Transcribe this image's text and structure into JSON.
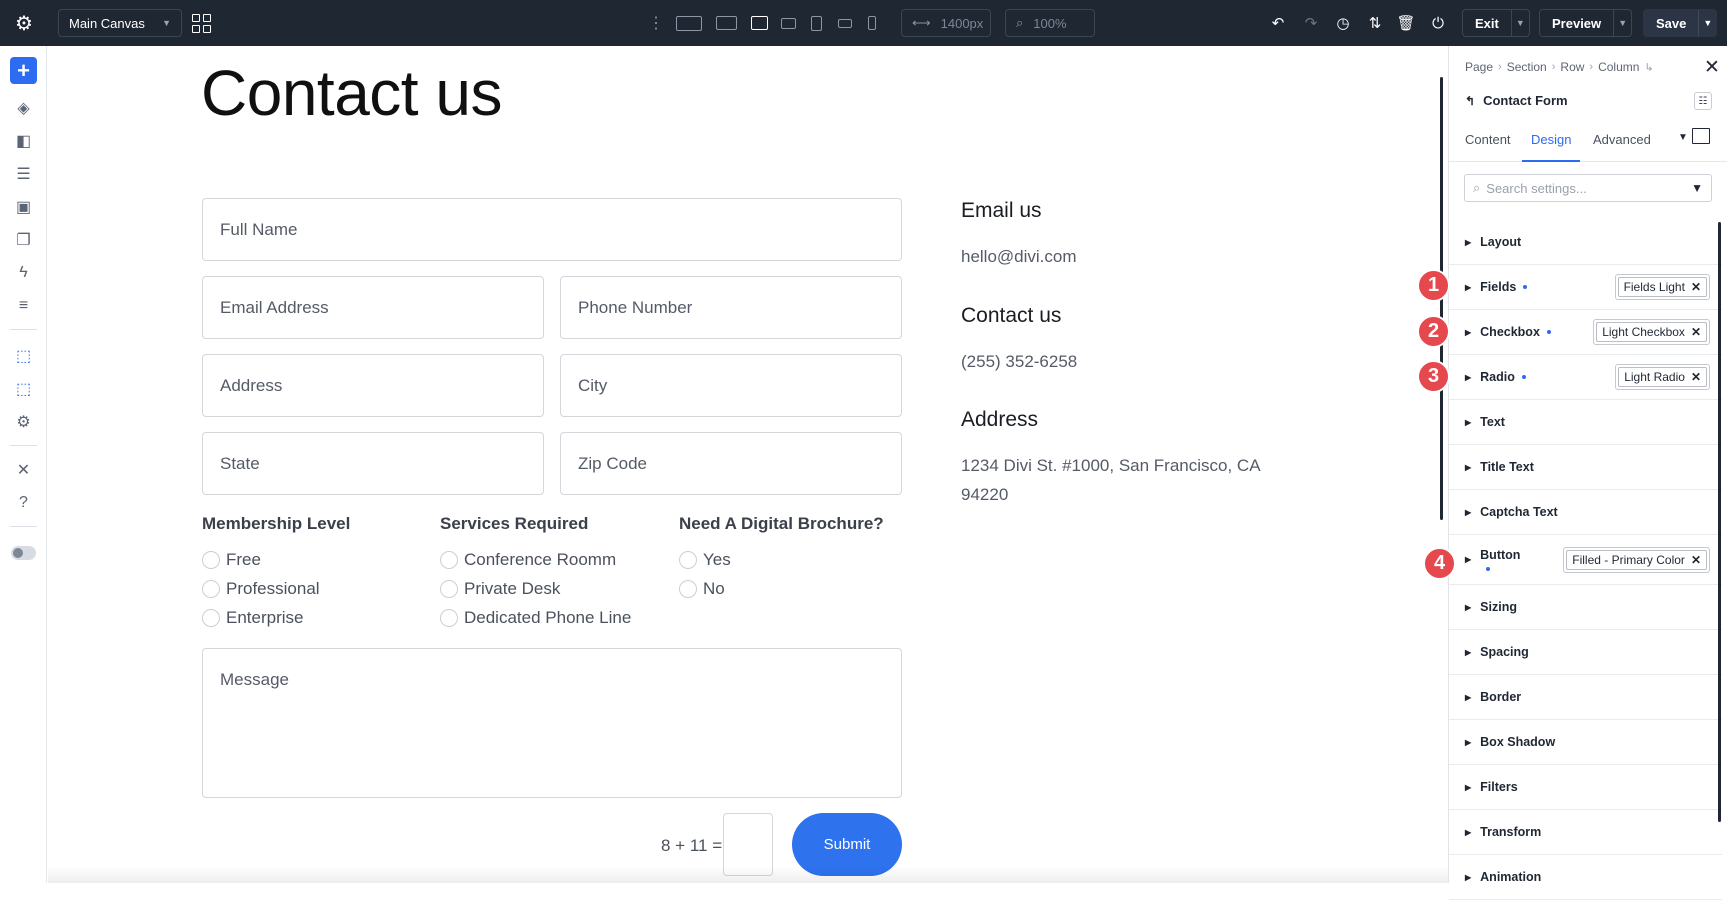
{
  "topbar": {
    "canvas_select": "Main Canvas",
    "width_value": "1400px",
    "zoom_value": "100%",
    "exit_label": "Exit",
    "preview_label": "Preview",
    "save_label": "Save"
  },
  "page": {
    "heading": "Contact us",
    "fields": {
      "full_name": "Full Name",
      "email": "Email Address",
      "phone": "Phone Number",
      "address": "Address",
      "city": "City",
      "state": "State",
      "zip": "Zip Code",
      "message": "Message"
    },
    "groups": [
      {
        "title": "Membership Level",
        "options": [
          "Free",
          "Professional",
          "Enterprise"
        ]
      },
      {
        "title": "Services Required",
        "options": [
          "Conference Roomm",
          "Private Desk",
          "Dedicated Phone Line"
        ]
      },
      {
        "title": "Need A Digital Brochure?",
        "options": [
          "Yes",
          "No"
        ]
      }
    ],
    "captcha": "8 + 11 =",
    "submit_label": "Submit",
    "info": {
      "email_heading": "Email us",
      "email_value": "hello@divi.com",
      "contact_heading": "Contact us",
      "phone_value": "(255) 352-6258",
      "address_heading": "Address",
      "address_line1": "1234 Divi St. #1000, San Francisco, CA",
      "address_line2": "94220"
    }
  },
  "panel": {
    "breadcrumb": [
      "Page",
      "Section",
      "Row",
      "Column"
    ],
    "title": "Contact Form",
    "tabs": [
      "Content",
      "Design",
      "Advanced"
    ],
    "active_tab": "Design",
    "search_placeholder": "Search settings...",
    "sections": [
      {
        "label": "Layout"
      },
      {
        "label": "Fields",
        "preset": "Fields Light",
        "badge": "1"
      },
      {
        "label": "Checkbox",
        "preset": "Light Checkbox",
        "badge": "2"
      },
      {
        "label": "Radio",
        "preset": "Light Radio",
        "badge": "3"
      },
      {
        "label": "Text"
      },
      {
        "label": "Title Text"
      },
      {
        "label": "Captcha Text"
      },
      {
        "label": "Button",
        "preset": "Filled - Primary Color",
        "badge": "4"
      },
      {
        "label": "Sizing"
      },
      {
        "label": "Spacing"
      },
      {
        "label": "Border"
      },
      {
        "label": "Box Shadow"
      },
      {
        "label": "Filters"
      },
      {
        "label": "Transform"
      },
      {
        "label": "Animation"
      }
    ]
  },
  "colors": {
    "accent": "#2d6bf0",
    "topbar": "#1f2733",
    "badge": "#e5484d",
    "submit": "#2e72ee"
  }
}
